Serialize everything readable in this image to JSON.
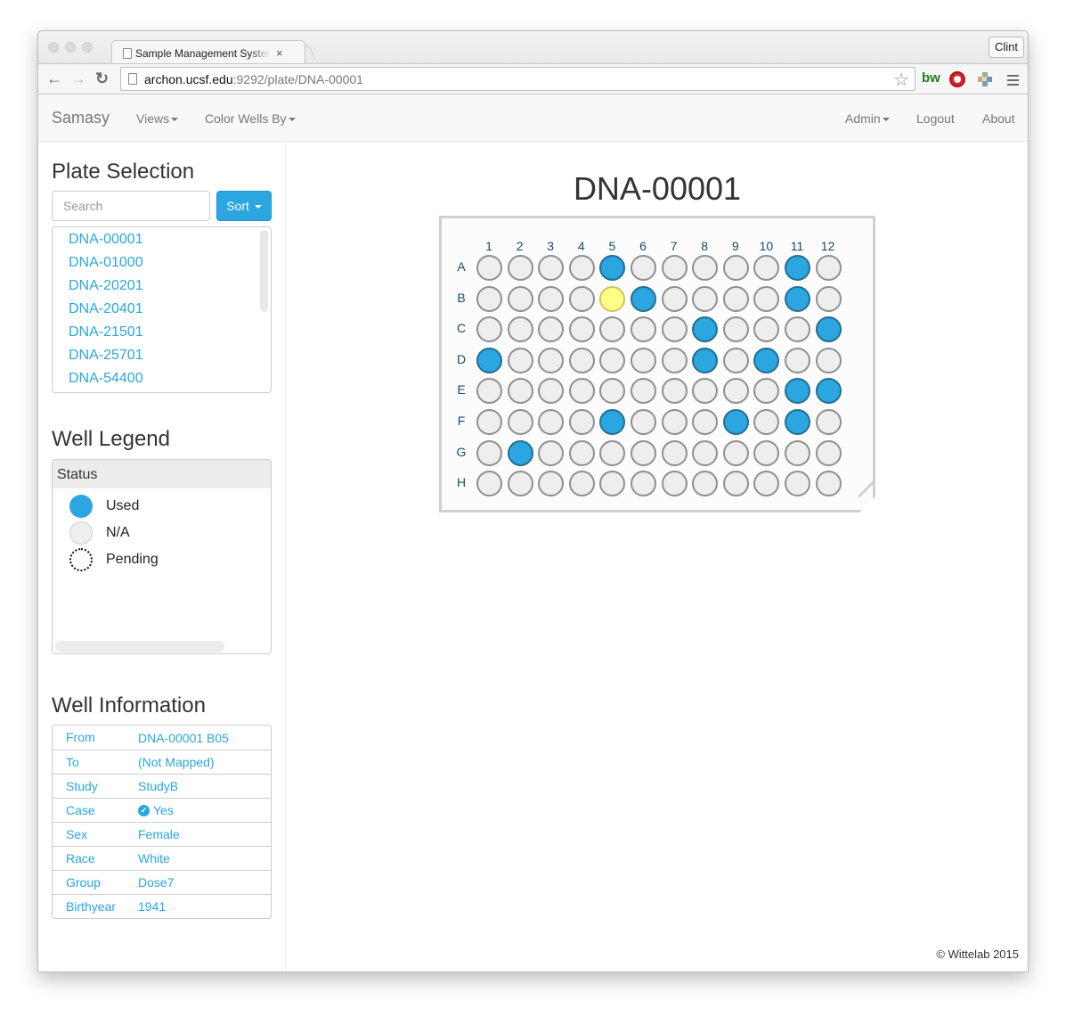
{
  "browser": {
    "tab_title": "Sample Management System",
    "url_host": "archon.ucsf.edu",
    "url_path": ":9292/plate/DNA-00001",
    "profile_name": "Clint",
    "extensions": [
      "bw-extension-icon",
      "adblock-stop-icon",
      "puzzle-extension-icon"
    ]
  },
  "navbar": {
    "brand": "Samasy",
    "left_items": [
      {
        "label": "Views",
        "dropdown": true
      },
      {
        "label": "Color Wells By",
        "dropdown": true
      }
    ],
    "right_items": [
      {
        "label": "Admin",
        "dropdown": true
      },
      {
        "label": "Logout",
        "dropdown": false
      },
      {
        "label": "About",
        "dropdown": false
      }
    ]
  },
  "plate_selection": {
    "heading": "Plate Selection",
    "search_placeholder": "Search",
    "search_value": "",
    "sort_label": "Sort",
    "plates": [
      "DNA-00001",
      "DNA-01000",
      "DNA-20201",
      "DNA-20401",
      "DNA-21501",
      "DNA-25701",
      "DNA-54400"
    ]
  },
  "well_legend": {
    "heading": "Well Legend",
    "panel_title": "Status",
    "items": [
      {
        "label": "Used",
        "style": "used",
        "color": "#2ba6e0"
      },
      {
        "label": "N/A",
        "style": "na",
        "color": "#eeeeee"
      },
      {
        "label": "Pending",
        "style": "pending",
        "color": "#ffffff"
      }
    ]
  },
  "well_information": {
    "heading": "Well Information",
    "rows": [
      {
        "key": "From",
        "value": "DNA-00001 B05",
        "icon": null
      },
      {
        "key": "To",
        "value": "(Not Mapped)",
        "icon": null
      },
      {
        "key": "Study",
        "value": "StudyB",
        "icon": null
      },
      {
        "key": "Case",
        "value": "Yes",
        "icon": "check-circle-icon"
      },
      {
        "key": "Sex",
        "value": "Female",
        "icon": null
      },
      {
        "key": "Race",
        "value": "White",
        "icon": null
      },
      {
        "key": "Group",
        "value": "Dose7",
        "icon": null
      },
      {
        "key": "Birthyear",
        "value": "1941",
        "icon": null
      }
    ]
  },
  "plate": {
    "title": "DNA-00001",
    "columns": [
      "1",
      "2",
      "3",
      "4",
      "5",
      "6",
      "7",
      "8",
      "9",
      "10",
      "11",
      "12"
    ],
    "rows": [
      "A",
      "B",
      "C",
      "D",
      "E",
      "F",
      "G",
      "H"
    ],
    "selected_well": "B05",
    "colors": {
      "used": "#2ba6e0",
      "na": "#eeeeee",
      "selected": "#ffff88"
    },
    "wells": {
      "A": [
        "na",
        "na",
        "na",
        "na",
        "used",
        "na",
        "na",
        "na",
        "na",
        "na",
        "used",
        "na"
      ],
      "B": [
        "na",
        "na",
        "na",
        "na",
        "selected",
        "used",
        "na",
        "na",
        "na",
        "na",
        "used",
        "na"
      ],
      "C": [
        "na",
        "na",
        "na",
        "na",
        "na",
        "na",
        "na",
        "used",
        "na",
        "na",
        "na",
        "used"
      ],
      "D": [
        "used",
        "na",
        "na",
        "na",
        "na",
        "na",
        "na",
        "used",
        "na",
        "used",
        "na",
        "na"
      ],
      "E": [
        "na",
        "na",
        "na",
        "na",
        "na",
        "na",
        "na",
        "na",
        "na",
        "na",
        "used",
        "used"
      ],
      "F": [
        "na",
        "na",
        "na",
        "na",
        "used",
        "na",
        "na",
        "na",
        "used",
        "na",
        "used",
        "na"
      ],
      "G": [
        "na",
        "used",
        "na",
        "na",
        "na",
        "na",
        "na",
        "na",
        "na",
        "na",
        "na",
        "na"
      ],
      "H": [
        "na",
        "na",
        "na",
        "na",
        "na",
        "na",
        "na",
        "na",
        "na",
        "na",
        "na",
        "na"
      ]
    }
  },
  "footer": {
    "copyright": "© Wittelab 2015"
  }
}
